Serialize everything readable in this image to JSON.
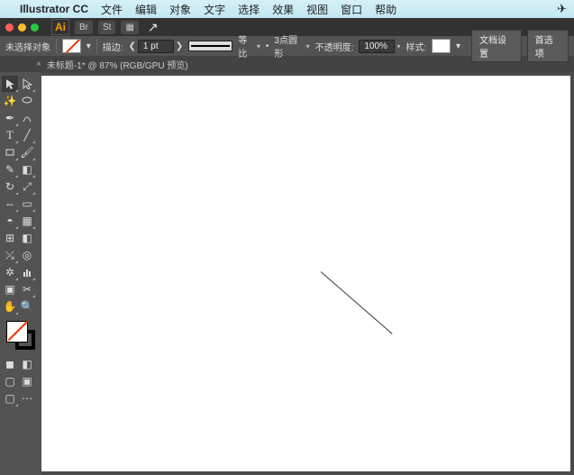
{
  "menubar": {
    "app": "Illustrator CC",
    "items": [
      "文件",
      "编辑",
      "对象",
      "文字",
      "选择",
      "效果",
      "视图",
      "窗口",
      "帮助"
    ]
  },
  "appbar": {
    "logo": "Ai",
    "buttons": [
      "Br",
      "St",
      "▦"
    ]
  },
  "control": {
    "selection": "未选择对象",
    "stroke_label": "描边:",
    "stroke_weight": "1 pt",
    "uniform": "等比",
    "profile": "3点圆形",
    "opacity_label": "不透明度:",
    "opacity_value": "100%",
    "style_label": "样式:",
    "doc_setup": "文档设置",
    "prefs": "首选项"
  },
  "tab": {
    "close": "×",
    "title": "未标题-1* @ 87% (RGB/GPU 预览)"
  },
  "tools": {
    "r0": [
      "selection",
      "direct-selection"
    ],
    "r1": [
      "magic-wand",
      "lasso"
    ],
    "r2": [
      "pen",
      "curvature"
    ],
    "r3": [
      "type",
      "line"
    ],
    "r4": [
      "rectangle",
      "paintbrush"
    ],
    "r5": [
      "shaper",
      "eraser"
    ],
    "r6": [
      "rotate",
      "scale"
    ],
    "r7": [
      "width",
      "free-transform"
    ],
    "r8": [
      "shape-builder",
      "perspective"
    ],
    "r9": [
      "mesh",
      "gradient"
    ],
    "r10": [
      "eyedropper",
      "blend"
    ],
    "r11": [
      "symbol-sprayer",
      "graph"
    ],
    "r12": [
      "artboard",
      "slice"
    ],
    "r13": [
      "hand",
      "zoom"
    ]
  },
  "colors": {
    "accent": "#ff9a00",
    "panel": "#535353"
  }
}
